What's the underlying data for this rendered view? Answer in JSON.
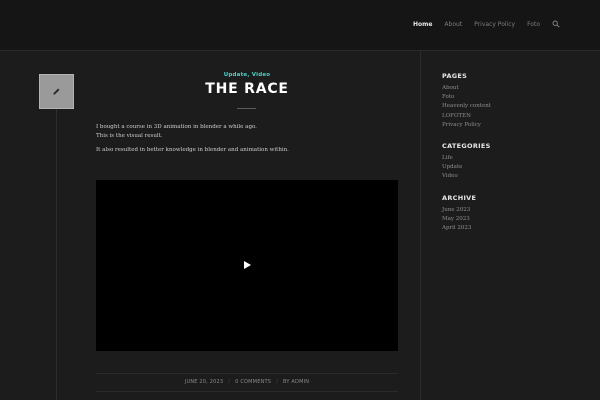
{
  "nav": {
    "items": [
      {
        "label": "Home",
        "active": true
      },
      {
        "label": "About",
        "active": false
      },
      {
        "label": "Privacy Policy",
        "active": false
      },
      {
        "label": "Foto",
        "active": false
      }
    ],
    "search_icon": "search-icon"
  },
  "post": {
    "format_icon": "pencil-icon",
    "categories": [
      "Update",
      "Video"
    ],
    "category_separator": ",",
    "title": "The Race",
    "body": [
      "I bought a course in 3D animation in blender a while ago.",
      "This is the visual result.",
      "It also resulted in better knowledge in blender and animation within."
    ],
    "video_play_icon": "play-icon",
    "footer": {
      "date": "June 20, 2023",
      "comments": "0 Comments",
      "author": "by admin"
    }
  },
  "sidebar": {
    "pages": {
      "title": "Pages",
      "items": [
        "About",
        "Foto",
        "Heavenly content",
        "LOFOTEN",
        "Privacy Policy"
      ]
    },
    "categories": {
      "title": "Categories",
      "items": [
        "Life",
        "Update",
        "Video"
      ]
    },
    "archive": {
      "title": "Archive",
      "items": [
        "June 2023",
        "May 2023",
        "April 2023"
      ]
    }
  },
  "colors": {
    "accent": "#4fd1c5",
    "background": "#1c1c1c",
    "header": "#151515"
  }
}
